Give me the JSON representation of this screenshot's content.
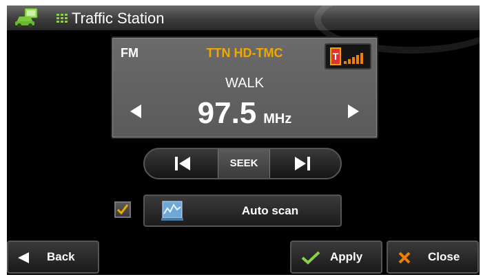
{
  "window": {
    "title": "Traffic Station"
  },
  "display": {
    "band": "FM",
    "station": "TTN HD-TMC",
    "rds_text": "WALK",
    "frequency": "97.5",
    "unit": "MHz",
    "signal_badge": "T"
  },
  "seek": {
    "label": "SEEK"
  },
  "autoscan": {
    "label": "Auto scan",
    "checked": true
  },
  "buttons": {
    "back": "Back",
    "apply": "Apply",
    "close": "Close"
  },
  "colors": {
    "accent": "#f0a800",
    "check": "#8ad14a",
    "close_x": "#f08000"
  },
  "icons": {
    "app": "car-monitor-icon",
    "menu": "grid-icon",
    "prev": "skip-back-icon",
    "next": "skip-forward-icon",
    "scan": "scan-chart-icon",
    "back": "triangle-left-icon",
    "apply": "checkmark-icon",
    "close": "x-icon"
  }
}
